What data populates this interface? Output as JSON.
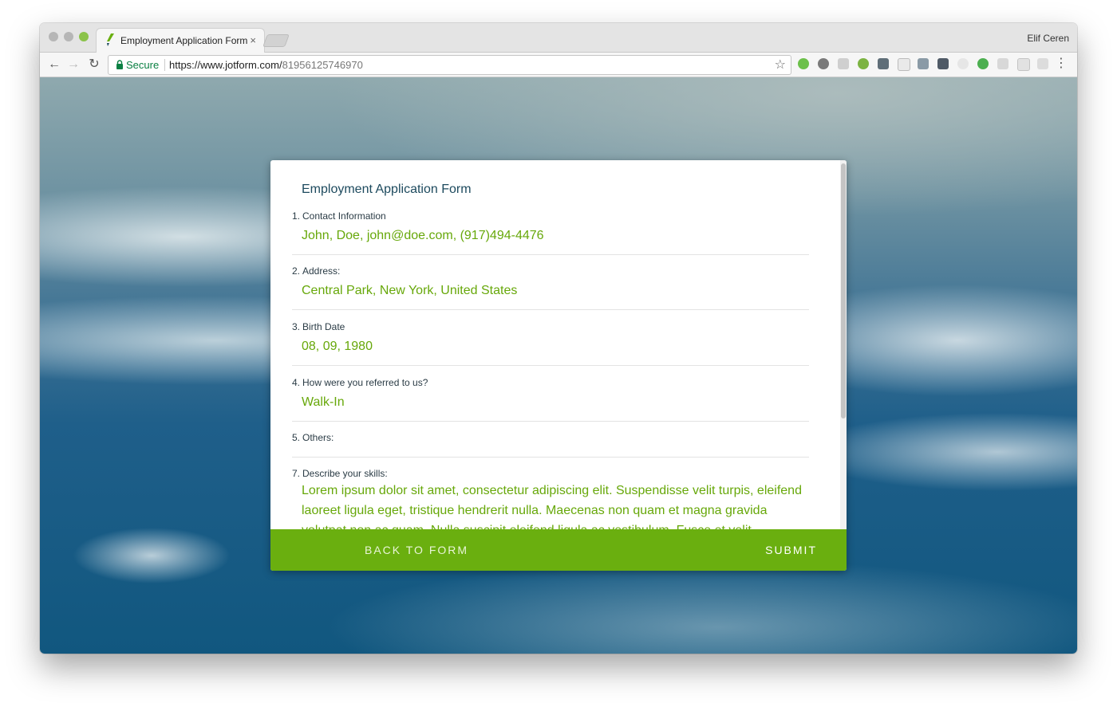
{
  "browser": {
    "tab_title": "Employment Application Form",
    "tab_close": "×",
    "profile_name": "Elif Ceren",
    "secure_label": "Secure",
    "url_scheme_host": "https://www.jotform.com/",
    "url_path": "81956125746970",
    "extensions": [
      "feedly-icon",
      "bear-icon",
      "screenshot-icon",
      "evernote-icon",
      "mail-icon",
      "json-icon",
      "translate-icon",
      "pocket-icon",
      "circle-icon",
      "grammarly-icon",
      "info-icon",
      "window-icon",
      "box-icon"
    ]
  },
  "form": {
    "title": "Employment Application Form",
    "questions": [
      {
        "num": "1.",
        "label": "Contact Information",
        "value": "John, Doe, john@doe.com, (917)494-4476"
      },
      {
        "num": "2.",
        "label": "Address:",
        "value": "Central Park, New York, United States"
      },
      {
        "num": "3.",
        "label": "Birth Date",
        "value": "08, 09, 1980"
      },
      {
        "num": "4.",
        "label": "How were you referred to us?",
        "value": "Walk-In"
      },
      {
        "num": "5.",
        "label": "Others:",
        "value": ""
      },
      {
        "num": "7.",
        "label": "Describe your skills:",
        "value": "Lorem ipsum dolor sit amet, consectetur adipiscing elit. Suspendisse velit turpis, eleifend laoreet ligula eget, tristique hendrerit nulla. Maecenas non quam et magna gravida volutpat non ac quam. Nulla suscipit eleifend ligula ac vestibulum. Fusce et velit"
      }
    ],
    "back_label": "BACK TO FORM",
    "submit_label": "SUBMIT"
  },
  "colors": {
    "accent_green": "#6aaf0f",
    "answer_green": "#67a80a",
    "title_blue": "#1d4a5e"
  }
}
